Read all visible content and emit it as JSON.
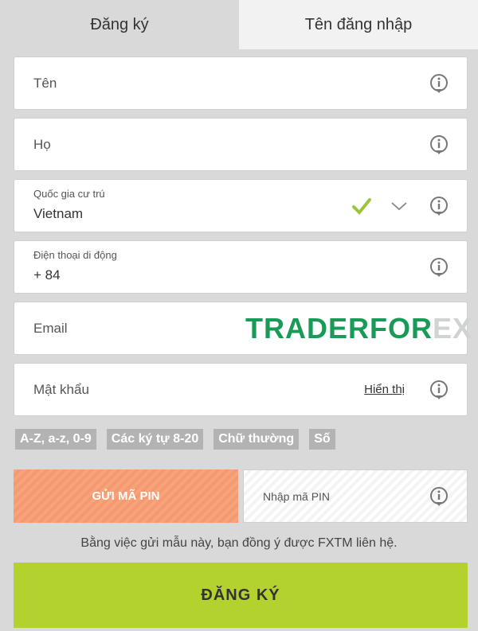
{
  "tabs": [
    {
      "label": "Đăng ký",
      "active": true
    },
    {
      "label": "Tên đăng nhập",
      "active": false
    }
  ],
  "fields": {
    "first_name": {
      "label": "Tên"
    },
    "last_name": {
      "label": "Họ"
    },
    "country": {
      "label": "Quốc gia cư trú",
      "value": "Vietnam"
    },
    "phone": {
      "label": "Điện thoại di động",
      "value": "+ 84"
    },
    "email": {
      "label": "Email"
    },
    "password": {
      "label": "Mật khẩu",
      "show_label": "Hiển thị"
    }
  },
  "watermark": {
    "text_main": "TRADERFOR",
    "text_fade": "EX"
  },
  "password_rules": [
    "A-Z, a-z, 0-9",
    "Các ký tự 8-20",
    "Chữ thường",
    "Số"
  ],
  "pin": {
    "send_label": "GỬI MÃ PIN",
    "input_placeholder": "Nhập mã PIN"
  },
  "consent_text": "Bằng việc gửi mẫu này, bạn đồng ý được FXTM liên hệ.",
  "submit_label": "ĐĂNG KÝ",
  "colors": {
    "accent_green": "#b3d22d",
    "pin_orange": "#f7a37b",
    "check_green": "#9bc53d",
    "watermark_green": "#1a9a57"
  }
}
